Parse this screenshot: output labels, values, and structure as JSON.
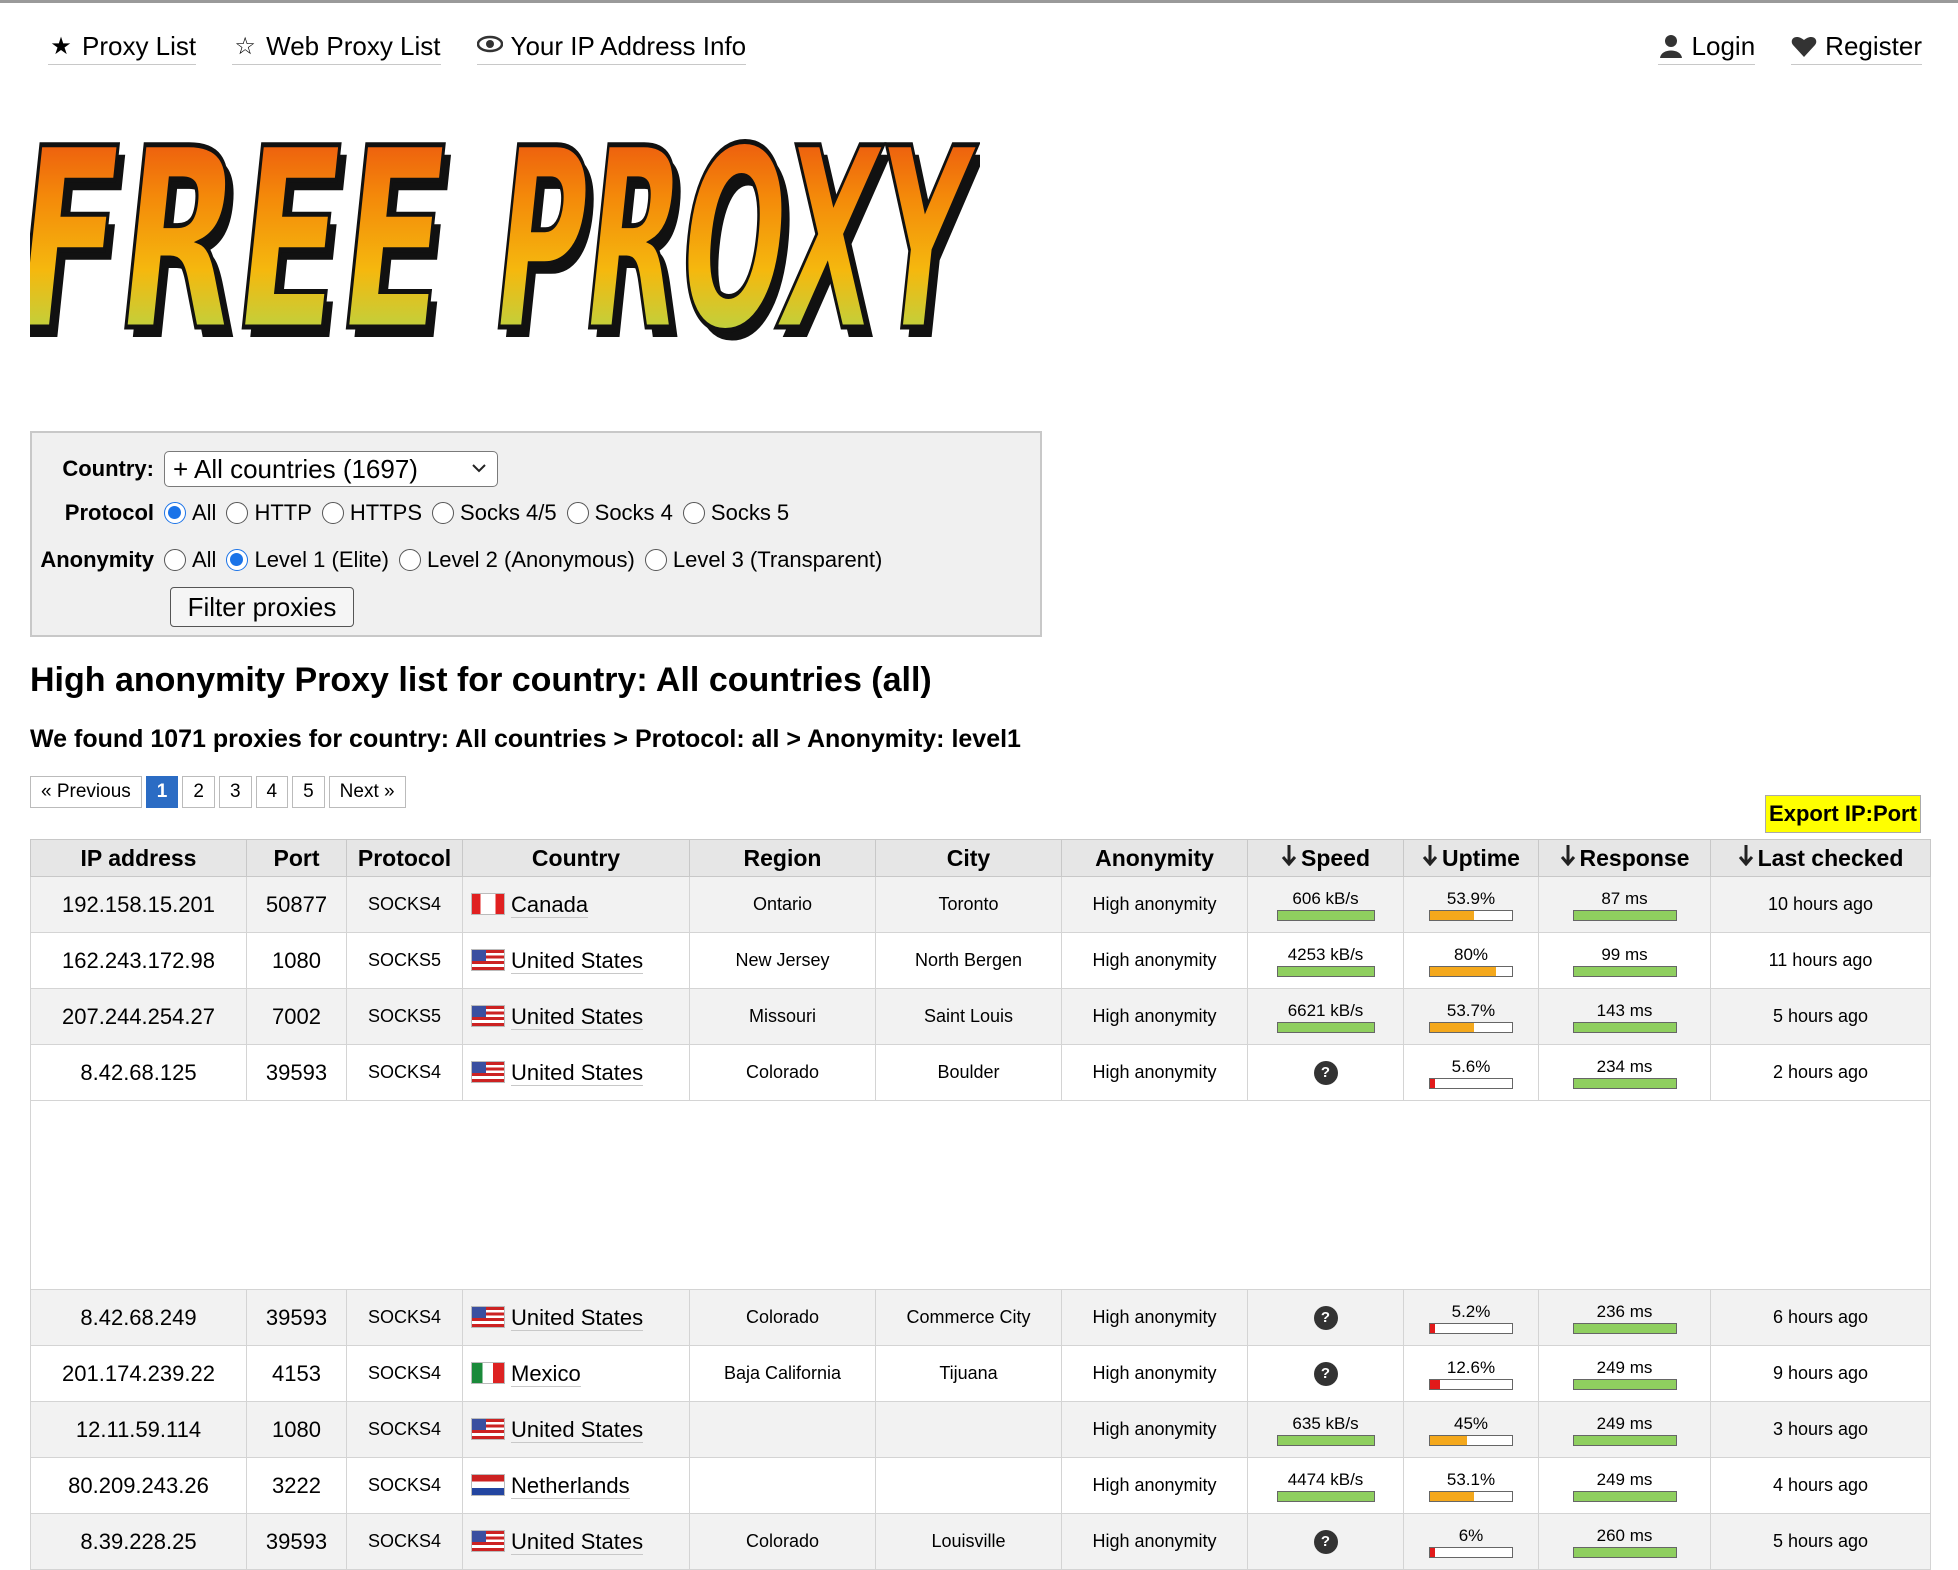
{
  "nav": {
    "left": [
      {
        "label": "Proxy List",
        "icon": "star-filled-icon"
      },
      {
        "label": "Web Proxy List",
        "icon": "star-outline-icon"
      },
      {
        "label": "Your IP Address Info",
        "icon": "eye-icon"
      }
    ],
    "right": [
      {
        "label": "Login",
        "icon": "user-icon"
      },
      {
        "label": "Register",
        "icon": "heart-icon"
      }
    ]
  },
  "logo": {
    "text": "FREE PROXY"
  },
  "filter": {
    "country_label": "Country:",
    "country_value": "+ All countries (1697)",
    "protocol_label": "Protocol",
    "protocol_options": [
      "All",
      "HTTP",
      "HTTPS",
      "Socks 4/5",
      "Socks 4",
      "Socks 5"
    ],
    "protocol_selected": 0,
    "anonymity_label": "Anonymity",
    "anonymity_options": [
      "All",
      "Level 1 (Elite)",
      "Level 2 (Anonymous)",
      "Level 3 (Transparent)"
    ],
    "anonymity_selected": 1,
    "button": "Filter proxies"
  },
  "title": "High anonymity Proxy list for country: All countries (all)",
  "subtitle": "We found 1071 proxies for country: All countries > Protocol: all > Anonymity: level1",
  "pagination": {
    "prev": "« Previous",
    "pages": [
      "1",
      "2",
      "3",
      "4",
      "5"
    ],
    "active": 0,
    "next": "Next »"
  },
  "export_label": "Export IP:Port",
  "colors": {
    "bar_green": "#8fcf5f",
    "bar_orange": "#f4a81c",
    "bar_red": "#e21a1a",
    "export_bg": "#ffff00",
    "active_page": "#2b6cc4"
  },
  "table": {
    "headers": [
      "IP address",
      "Port",
      "Protocol",
      "Country",
      "Region",
      "City",
      "Anonymity",
      "Speed",
      "Uptime",
      "Response",
      "Last checked"
    ],
    "sortable": [
      false,
      false,
      false,
      false,
      false,
      false,
      false,
      true,
      true,
      true,
      true
    ],
    "rows": [
      {
        "ip": "192.158.15.201",
        "port": "50877",
        "protocol": "SOCKS4",
        "flag": "ca",
        "country": "Canada",
        "region": "Ontario",
        "city": "Toronto",
        "anonymity": "High anonymity",
        "speed": "606 kB/s",
        "uptime": "53.9%",
        "uptime_level": 0.539,
        "uptime_color": "orange",
        "response": "87 ms",
        "checked": "10 hours ago"
      },
      {
        "ip": "162.243.172.98",
        "port": "1080",
        "protocol": "SOCKS5",
        "flag": "us",
        "country": "United States",
        "region": "New Jersey",
        "city": "North Bergen",
        "anonymity": "High anonymity",
        "speed": "4253 kB/s",
        "uptime": "80%",
        "uptime_level": 0.8,
        "uptime_color": "orange",
        "response": "99 ms",
        "checked": "11 hours ago"
      },
      {
        "ip": "207.244.254.27",
        "port": "7002",
        "protocol": "SOCKS5",
        "flag": "us",
        "country": "United States",
        "region": "Missouri",
        "city": "Saint Louis",
        "anonymity": "High anonymity",
        "speed": "6621 kB/s",
        "uptime": "53.7%",
        "uptime_level": 0.537,
        "uptime_color": "orange",
        "response": "143 ms",
        "checked": "5 hours ago"
      },
      {
        "ip": "8.42.68.125",
        "port": "39593",
        "protocol": "SOCKS4",
        "flag": "us",
        "country": "United States",
        "region": "Colorado",
        "city": "Boulder",
        "anonymity": "High anonymity",
        "speed": null,
        "uptime": "5.6%",
        "uptime_level": 0.056,
        "uptime_color": "red",
        "response": "234 ms",
        "checked": "2 hours ago"
      },
      {
        "ad": true
      },
      {
        "ip": "8.42.68.249",
        "port": "39593",
        "protocol": "SOCKS4",
        "flag": "us",
        "country": "United States",
        "region": "Colorado",
        "city": "Commerce City",
        "anonymity": "High anonymity",
        "speed": null,
        "uptime": "5.2%",
        "uptime_level": 0.052,
        "uptime_color": "red",
        "response": "236 ms",
        "checked": "6 hours ago"
      },
      {
        "ip": "201.174.239.22",
        "port": "4153",
        "protocol": "SOCKS4",
        "flag": "mx",
        "country": "Mexico",
        "region": "Baja California",
        "city": "Tijuana",
        "anonymity": "High anonymity",
        "speed": null,
        "uptime": "12.6%",
        "uptime_level": 0.126,
        "uptime_color": "red",
        "response": "249 ms",
        "checked": "9 hours ago"
      },
      {
        "ip": "12.11.59.114",
        "port": "1080",
        "protocol": "SOCKS4",
        "flag": "us",
        "country": "United States",
        "region": "",
        "city": "",
        "anonymity": "High anonymity",
        "speed": "635 kB/s",
        "uptime": "45%",
        "uptime_level": 0.45,
        "uptime_color": "orange",
        "response": "249 ms",
        "checked": "3 hours ago"
      },
      {
        "ip": "80.209.243.26",
        "port": "3222",
        "protocol": "SOCKS4",
        "flag": "nl",
        "country": "Netherlands",
        "region": "",
        "city": "",
        "anonymity": "High anonymity",
        "speed": "4474 kB/s",
        "uptime": "53.1%",
        "uptime_level": 0.531,
        "uptime_color": "orange",
        "response": "249 ms",
        "checked": "4 hours ago"
      },
      {
        "ip": "8.39.228.25",
        "port": "39593",
        "protocol": "SOCKS4",
        "flag": "us",
        "country": "United States",
        "region": "Colorado",
        "city": "Louisville",
        "anonymity": "High anonymity",
        "speed": null,
        "uptime": "6%",
        "uptime_level": 0.06,
        "uptime_color": "red",
        "response": "260 ms",
        "checked": "5 hours ago"
      }
    ]
  }
}
